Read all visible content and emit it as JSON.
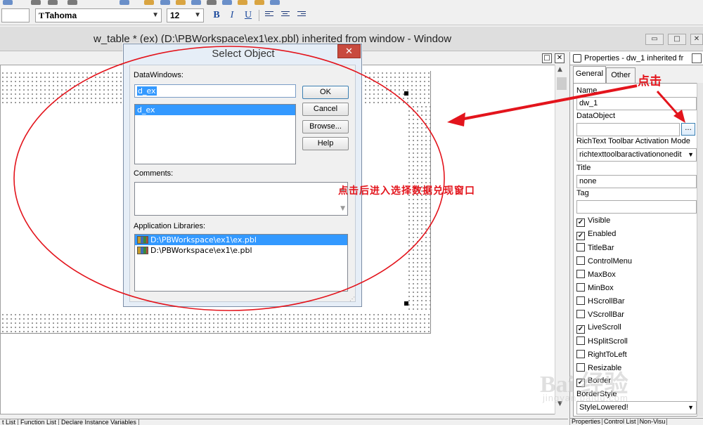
{
  "toolbar": {
    "font_name": "Tahoma",
    "font_size": "12",
    "bold_label": "B",
    "italic_label": "I",
    "underline_label": "U"
  },
  "window": {
    "title": "w_table * (ex) (D:\\PBWorkspace\\ex1\\ex.pbl) inherited from window - Window"
  },
  "dialog": {
    "title": "Select Object",
    "datawindows_label": "DataWindows:",
    "datawindow_value": "d_ex",
    "datawindow_items": [
      "d_ex"
    ],
    "ok_label": "OK",
    "cancel_label": "Cancel",
    "browse_label": "Browse...",
    "help_label": "Help",
    "comments_label": "Comments:",
    "libraries_label": "Application Libraries:",
    "libraries": [
      "D:\\PBWorkspace\\ex1\\ex.pbl",
      "D:\\PBWorkspace\\ex1\\e.pbl"
    ]
  },
  "properties": {
    "header": "Properties - dw_1 inherited fr",
    "tabs": [
      "General",
      "Other"
    ],
    "name_label": "Name",
    "name_value": "dw_1",
    "dataobject_label": "DataObject",
    "dataobject_value": "",
    "browse_button": "...",
    "richtext_label": "RichText Toolbar Activation Mode",
    "richtext_value": "richtexttoolbaractivationonedit",
    "title_label": "Title",
    "title_value": "none",
    "tag_label": "Tag",
    "tag_value": "",
    "checkboxes": [
      {
        "label": "Visible",
        "checked": true
      },
      {
        "label": "Enabled",
        "checked": true
      },
      {
        "label": "TitleBar",
        "checked": false
      },
      {
        "label": "ControlMenu",
        "checked": false
      },
      {
        "label": "MaxBox",
        "checked": false
      },
      {
        "label": "MinBox",
        "checked": false
      },
      {
        "label": "HScrollBar",
        "checked": false
      },
      {
        "label": "VScrollBar",
        "checked": false
      },
      {
        "label": "LiveScroll",
        "checked": true
      },
      {
        "label": "HSplitScroll",
        "checked": false
      },
      {
        "label": "RightToLeft",
        "checked": false
      },
      {
        "label": "Resizable",
        "checked": false
      },
      {
        "label": "Border",
        "checked": true
      }
    ],
    "borderstyle_label": "BorderStyle",
    "borderstyle_value": "StyleLowered!",
    "bottom_tabs": [
      "Properties",
      "Control List",
      "Non-Visu"
    ]
  },
  "bottom_tabs": [
    "t List",
    "Function List",
    "Declare Instance Variables"
  ],
  "annotations": {
    "click": "点击",
    "description": "点击后进入选择数据兑现窗口",
    "color": "#e3141c"
  },
  "watermark": {
    "brand": "Bai 经验",
    "url": "jingyan.baidu.com"
  }
}
